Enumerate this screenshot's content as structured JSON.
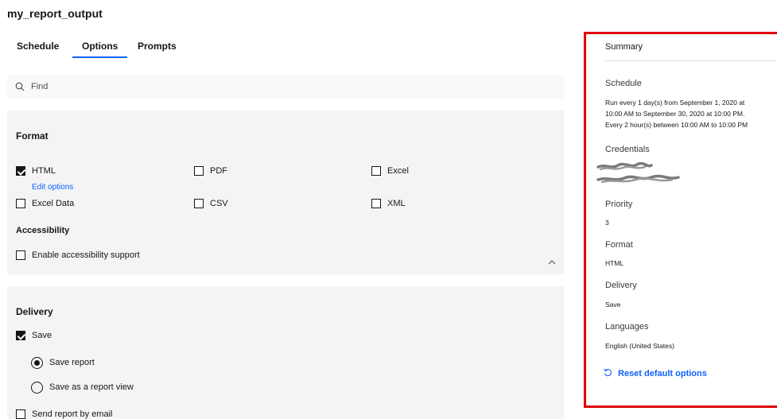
{
  "page": {
    "title": "my_report_output"
  },
  "tabs": [
    {
      "label": "Schedule"
    },
    {
      "label": "Options",
      "active": true
    },
    {
      "label": "Prompts"
    }
  ],
  "search": {
    "placeholder": "Find",
    "value": ""
  },
  "format": {
    "heading": "Format",
    "options": [
      {
        "label": "HTML",
        "checked": true
      },
      {
        "label": "PDF",
        "checked": false
      },
      {
        "label": "Excel",
        "checked": false
      },
      {
        "label": "Excel Data",
        "checked": false
      },
      {
        "label": "CSV",
        "checked": false
      },
      {
        "label": "XML",
        "checked": false
      }
    ],
    "edit_options": "Edit options",
    "accessibility": {
      "heading": "Accessibility",
      "option": {
        "label": "Enable accessibility support",
        "checked": false
      }
    }
  },
  "delivery": {
    "heading": "Delivery",
    "save": {
      "label": "Save",
      "checked": true
    },
    "radios": [
      {
        "label": "Save report",
        "selected": true
      },
      {
        "label": "Save as a report view",
        "selected": false
      }
    ],
    "email": {
      "label": "Send report by email",
      "checked": false
    }
  },
  "summary": {
    "title": "Summary",
    "schedule": {
      "label": "Schedule",
      "lines": [
        "Run every 1 day(s) from September 1, 2020 at",
        "10:00 AM to September 30, 2020 at 10:00 PM.",
        "Every 2 hour(s) between 10:00 AM to 10:00 PM"
      ]
    },
    "credentials": {
      "label": "Credentials"
    },
    "priority": {
      "label": "Priority",
      "value": "3"
    },
    "format": {
      "label": "Format",
      "value": "HTML"
    },
    "delivery": {
      "label": "Delivery",
      "value": "Save"
    },
    "languages": {
      "label": "Languages",
      "value": "English (United States)"
    },
    "reset": "Reset default options"
  },
  "colors": {
    "accent": "#0f62fe",
    "highlight_border": "#e0000d",
    "panel": "#f4f4f4"
  }
}
